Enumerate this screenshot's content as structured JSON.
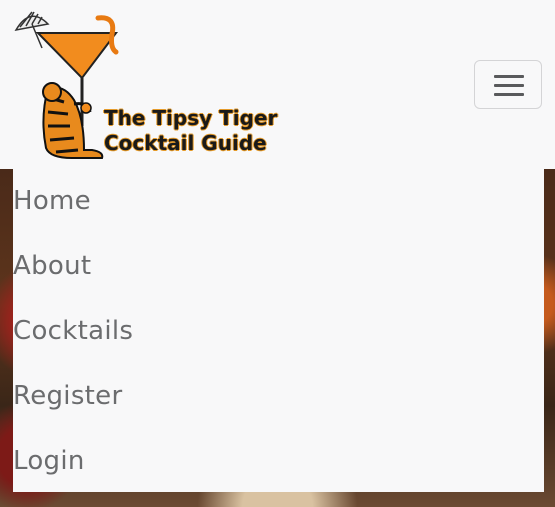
{
  "brand": {
    "name_line1": "The Tipsy Tiger",
    "name_line2": "Cocktail Guide",
    "logo_icon": "tiger-martini-logo-icon"
  },
  "navbar": {
    "toggler_icon": "hamburger-menu-icon"
  },
  "nav": {
    "items": [
      {
        "label": "Home"
      },
      {
        "label": "About"
      },
      {
        "label": "Cocktails"
      },
      {
        "label": "Register"
      },
      {
        "label": "Login"
      }
    ]
  },
  "colors": {
    "navbar_bg": "#f8f8f9",
    "nav_text": "#6b6c6e",
    "logo_orange": "#f28c1e",
    "logo_text_outline": "#e59b2b"
  }
}
